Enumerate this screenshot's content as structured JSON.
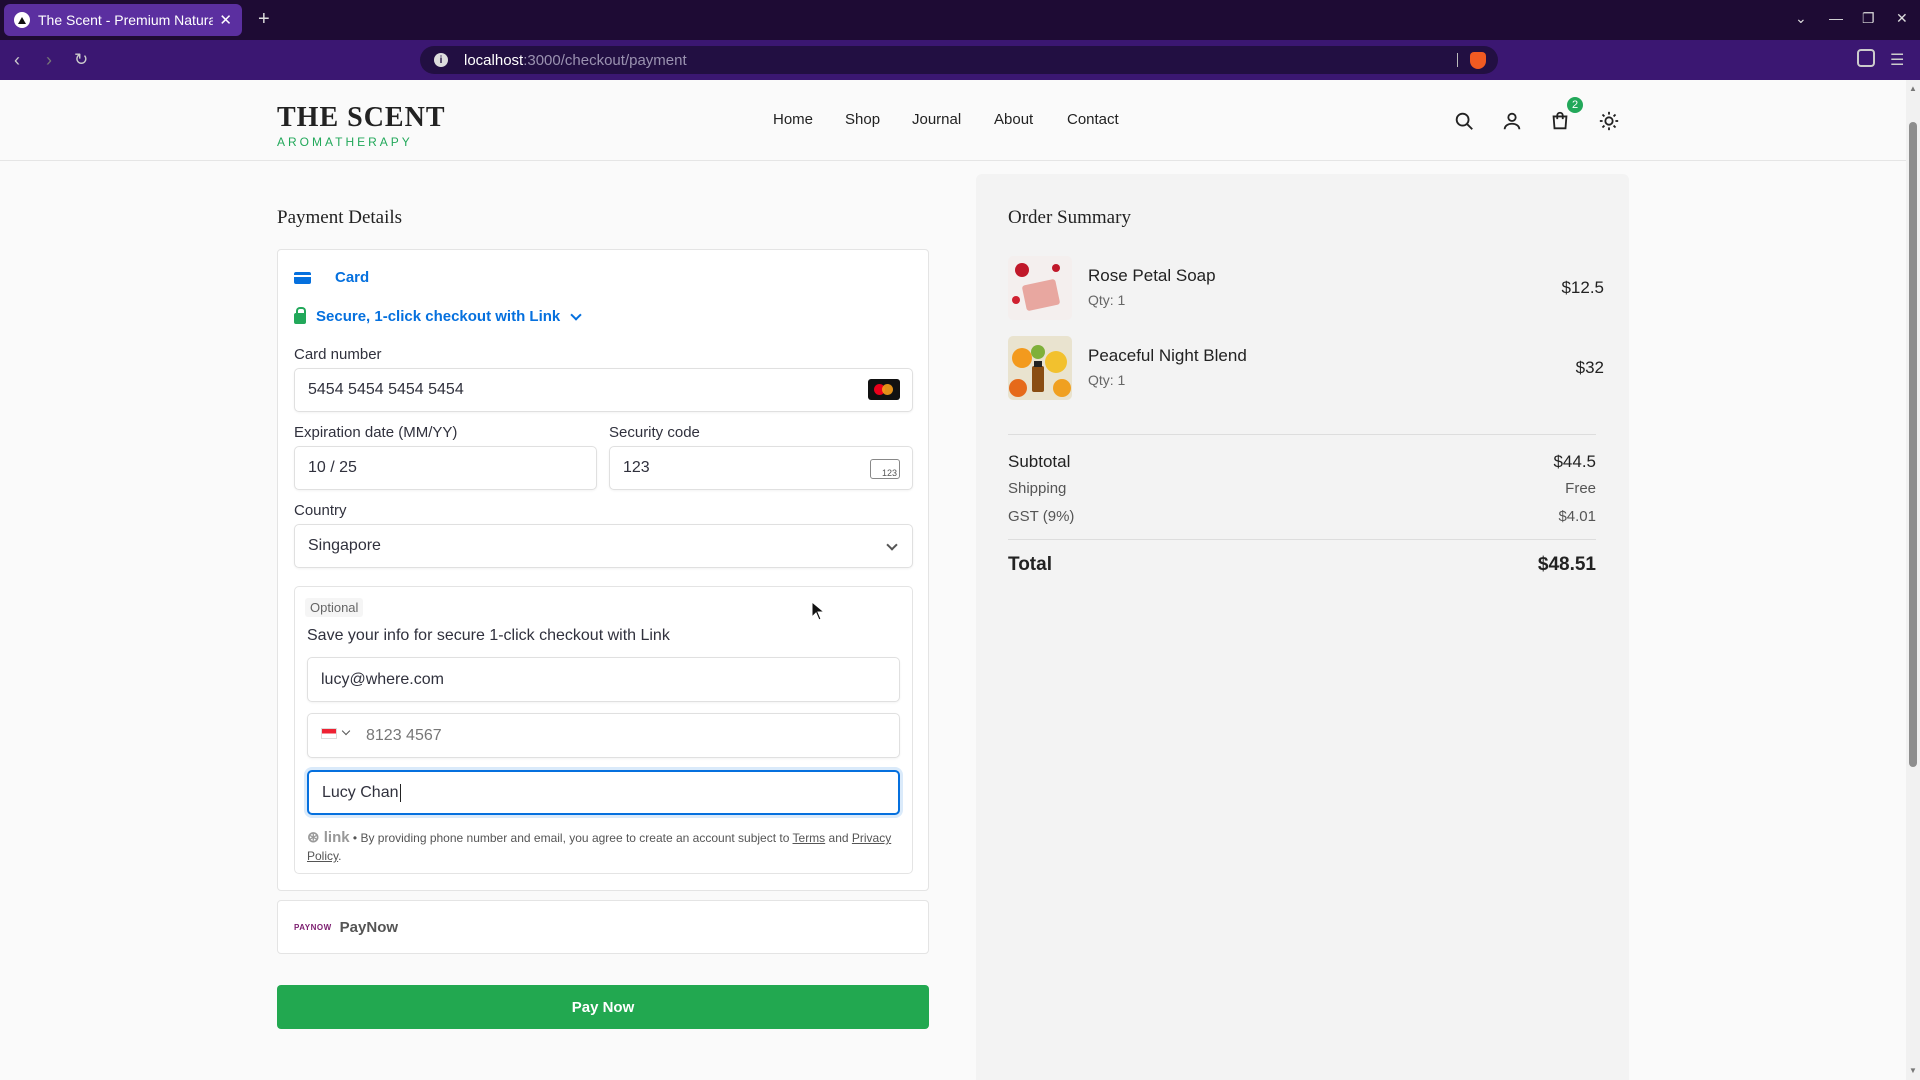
{
  "browser": {
    "tab_title": "The Scent - Premium Natura",
    "url_host": "localhost",
    "url_path": ":3000/checkout/payment"
  },
  "header": {
    "logo_title": "THE SCENT",
    "logo_subtitle": "AROMATHERAPY",
    "nav": [
      "Home",
      "Shop",
      "Journal",
      "About",
      "Contact"
    ],
    "cart_count": "2",
    "icons": [
      "search-icon",
      "user-icon",
      "cart-icon",
      "sun-icon"
    ]
  },
  "payment": {
    "title": "Payment Details",
    "method_tab": "Card",
    "link_text": "Secure, 1-click checkout with Link",
    "card_number_label": "Card number",
    "card_number": "5454 5454 5454 5454",
    "expiry_label": "Expiration date (MM/YY)",
    "expiry": "10 / 25",
    "cvc_label": "Security code",
    "cvc": "123",
    "cvc_icon_text": "123",
    "country_label": "Country",
    "country": "Singapore",
    "optional_tag": "Optional",
    "save_info": "Save your info for secure 1-click checkout with Link",
    "email": "lucy@where.com",
    "phone_placeholder": "8123 4567",
    "name": "Lucy Chan",
    "legal_link": "link",
    "legal_text": " • By providing phone number and email, you agree to create an account subject to ",
    "terms": "Terms",
    "and": " and ",
    "privacy": "Privacy Policy",
    "legal_end": ".",
    "paynow_logo": "PAYNOW",
    "paynow_label": "PayNow",
    "pay_button": "Pay Now"
  },
  "summary": {
    "title": "Order Summary",
    "items": [
      {
        "name": "Rose Petal Soap",
        "qty": "Qty: 1",
        "price": "$12.5"
      },
      {
        "name": "Peaceful Night Blend",
        "qty": "Qty: 1",
        "price": "$32"
      }
    ],
    "subtotal_label": "Subtotal",
    "subtotal": "$44.5",
    "shipping_label": "Shipping",
    "shipping": "Free",
    "tax_label": "GST (9%)",
    "tax": "$4.01",
    "total_label": "Total",
    "total": "$48.51"
  },
  "colors": {
    "accent": "#0570de",
    "brand_green": "#22a85a",
    "browser_purple": "#3b1772"
  }
}
